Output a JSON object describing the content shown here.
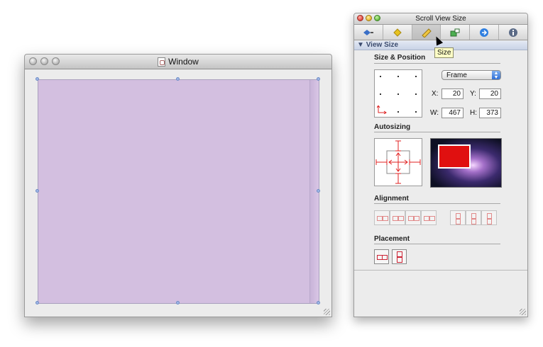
{
  "window": {
    "title": "Window"
  },
  "inspector": {
    "title": "Scroll View Size",
    "tabs": [
      "attributes-icon",
      "effects-icon",
      "size-icon",
      "connections-icon",
      "bindings-icon",
      "identity-icon"
    ],
    "selected_tab": "size-icon",
    "tooltip": "Size",
    "section": "View Size",
    "size_position": {
      "heading": "Size & Position",
      "frame_menu": "Frame",
      "x_label": "X:",
      "x": "20",
      "y_label": "Y:",
      "y": "20",
      "w_label": "W:",
      "w": "467",
      "h_label": "H:",
      "h": "373"
    },
    "autosizing": {
      "heading": "Autosizing"
    },
    "alignment": {
      "heading": "Alignment"
    },
    "placement": {
      "heading": "Placement"
    }
  },
  "colors": {
    "content_view": "#d3bfe0",
    "accent_red": "#e02020",
    "section_header": "#c9d3e6"
  }
}
